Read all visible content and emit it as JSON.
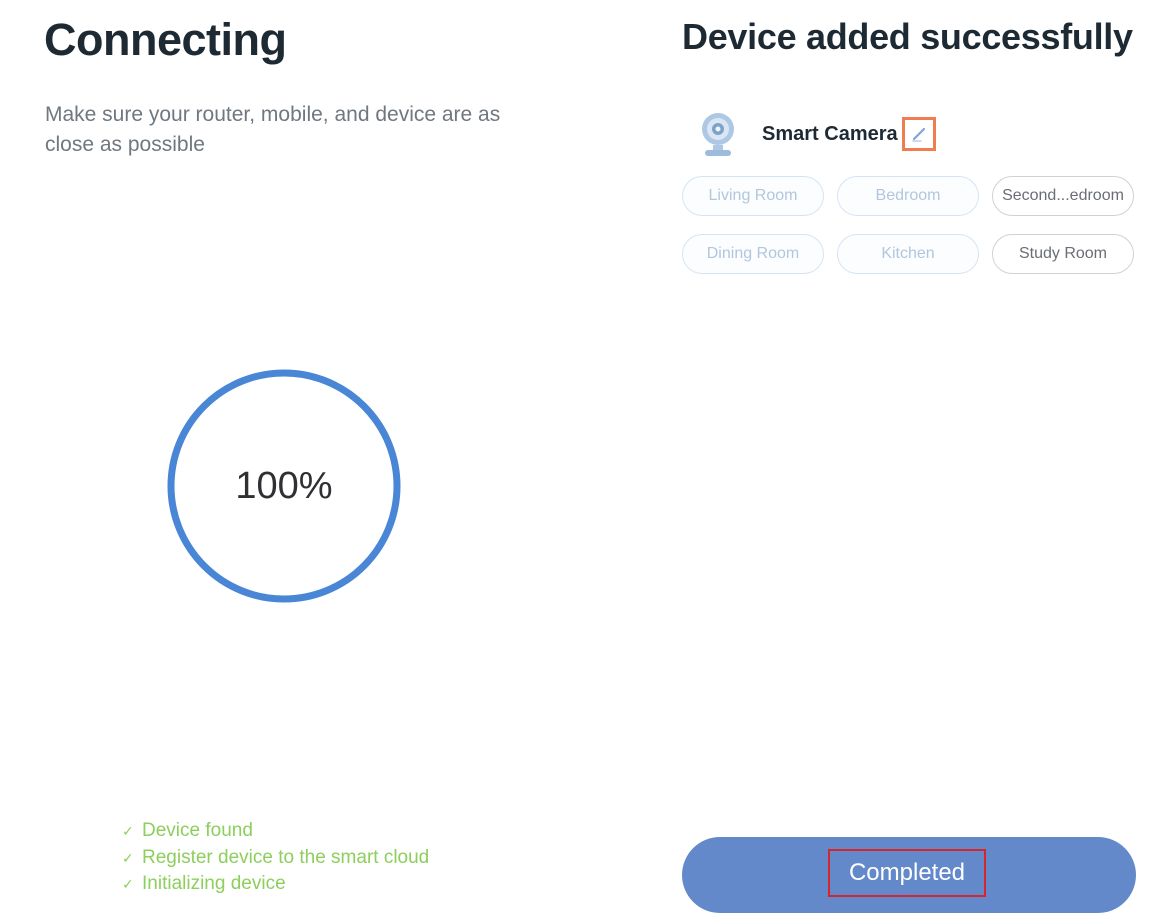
{
  "connecting": {
    "title": "Connecting",
    "subtitle": "Make sure your router, mobile, and device are as close as possible",
    "progress": {
      "label": "100%",
      "value": 1.0,
      "ring_color": "#4a86d6"
    },
    "steps": [
      {
        "icon": "check-icon",
        "label": "Device found"
      },
      {
        "icon": "check-icon",
        "label": "Register device to the smart cloud"
      },
      {
        "icon": "check-icon",
        "label": "Initializing device"
      }
    ],
    "step_color": "#8ccf5c"
  },
  "device_added": {
    "title": "Device added successfully",
    "device": {
      "icon": "camera-icon",
      "name": "Smart Camera",
      "edit_icon": "pencil-icon",
      "edit_highlight_color": "#f07c52"
    },
    "rooms": [
      {
        "label": "Living Room",
        "style": "faded"
      },
      {
        "label": "Bedroom",
        "style": "faded"
      },
      {
        "label": "Second...edroom",
        "style": "plain"
      },
      {
        "label": "Dining Room",
        "style": "faded"
      },
      {
        "label": "Kitchen",
        "style": "faded"
      },
      {
        "label": "Study Room",
        "style": "plain"
      }
    ],
    "completed_button": {
      "label": "Completed",
      "color": "#6389cb",
      "highlight_color": "#d4262c"
    }
  }
}
